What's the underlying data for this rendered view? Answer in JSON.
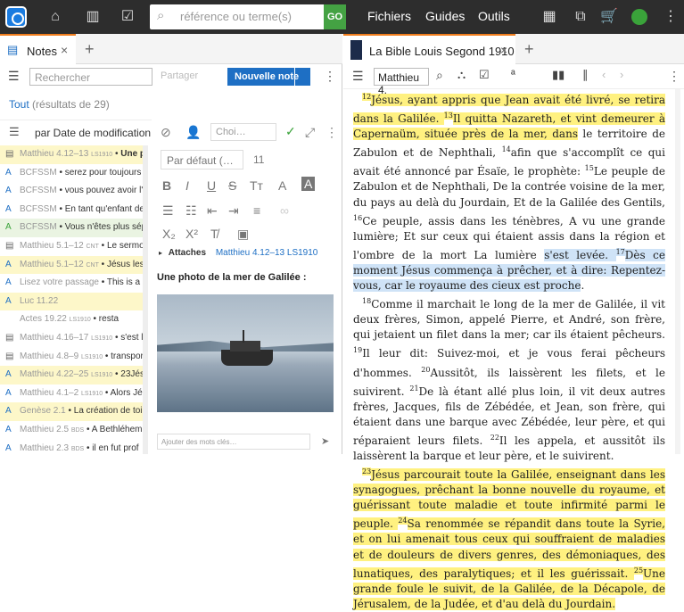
{
  "topbar": {
    "search_placeholder": "référence ou terme(s)",
    "go": "GO",
    "menus": [
      "Fichiers",
      "Guides",
      "Outils"
    ]
  },
  "left_tab": {
    "title": "Notes",
    "close": "×"
  },
  "right_tab": {
    "title": "La Bible Louis Segond 1910",
    "close": "×"
  },
  "notes_toolbar": {
    "search_placeholder": "Rechercher",
    "share": "Partager",
    "new_note": "Nouvelle note"
  },
  "filter": {
    "label": "Tout",
    "count": "(résultats de 29)"
  },
  "sort": {
    "label": "par Date de modification"
  },
  "notes": [
    {
      "icon": "note",
      "ref": "Matthieu 4.12–13",
      "abbr": "LS1910",
      "text": "Une p",
      "style": "hlY",
      "bold": true
    },
    {
      "icon": "A",
      "ref": "BCFSSM",
      "abbr": "",
      "text": "serez pour toujours l'",
      "style": ""
    },
    {
      "icon": "A",
      "ref": "BCFSSM",
      "abbr": "",
      "text": "vous pouvez avoir l'a",
      "style": ""
    },
    {
      "icon": "A",
      "ref": "BCFSSM",
      "abbr": "",
      "text": "En tant qu'enfant de",
      "style": ""
    },
    {
      "icon": "A",
      "ref": "BCFSSM",
      "abbr": "",
      "text": "Vous n'êtes plus sépa",
      "style": "hlG"
    },
    {
      "icon": "note",
      "ref": "Matthieu 5.1–12",
      "abbr": "CNT",
      "text": "Le sermo",
      "style": ""
    },
    {
      "icon": "A",
      "ref": "Matthieu 5.1–12",
      "abbr": "CNT",
      "text": "Jésus les",
      "style": "hlY"
    },
    {
      "icon": "A",
      "ref": "Lisez votre passage",
      "abbr": "",
      "text": "This is a te",
      "style": ""
    },
    {
      "icon": "A",
      "ref": "Luc 11.22",
      "abbr": "",
      "text": "",
      "style": "hlY"
    },
    {
      "icon": "",
      "ref": "Actes 19.22",
      "abbr": "LS1910",
      "text": "resta",
      "style": ""
    },
    {
      "icon": "note",
      "ref": "Matthieu 4.16–17",
      "abbr": "LS1910",
      "text": "s'est l",
      "style": ""
    },
    {
      "icon": "note",
      "ref": "Matthieu 4.8–9",
      "abbr": "LS1910",
      "text": "transpor",
      "style": ""
    },
    {
      "icon": "A",
      "ref": "Matthieu 4.22–25",
      "abbr": "LS1910",
      "text": "23Jés",
      "style": "hlY"
    },
    {
      "icon": "A",
      "ref": "Matthieu 4.1–2",
      "abbr": "LS1910",
      "text": "Alors Jé",
      "style": ""
    },
    {
      "icon": "A",
      "ref": "Genèse 2.1",
      "abbr": "",
      "text": "La création de toi",
      "style": "hlY"
    },
    {
      "icon": "A",
      "ref": "Matthieu 2.5",
      "abbr": "BDS",
      "text": "A Bethléhem",
      "style": ""
    },
    {
      "icon": "A",
      "ref": "Matthieu 2.3",
      "abbr": "BDS",
      "text": "il en fut prof",
      "style": ""
    }
  ],
  "editor": {
    "font": "Par défaut (…",
    "size": "11",
    "attaches_label": "Attaches",
    "attaches_ref": "Matthieu 4.12–13 LS1910",
    "photo_caption": "Une photo de la mer de Galilée :",
    "keywords_placeholder": "Ajouter des mots clés…",
    "choice": "Choi…"
  },
  "bible": {
    "ref": "Matthieu 4.",
    "paragraphs": [
      [
        [
          "12",
          "y"
        ],
        [
          "Jésus, ayant appris que Jean avait été livré, se retira dans la Galilée. ",
          "y"
        ],
        [
          "13",
          "y"
        ],
        [
          "Il quitta Nazareth, et vint demeurer à Capernaüm, située près de la mer, dans",
          "y"
        ],
        [
          " le territoire de Zabulon et de Nephthali, ",
          ""
        ],
        [
          "14",
          ""
        ],
        [
          "afin que s'accomplît ce qui avait été annoncé par Ésaïe, le prophète: ",
          ""
        ],
        [
          "15",
          ""
        ],
        [
          "Le peuple de Zabulon et de Nephthali, De la contrée voisine de la mer, du pays au delà du Jourdain, Et de la Galilée des Gentils, ",
          ""
        ],
        [
          "16",
          ""
        ],
        [
          "Ce peuple, assis dans les ténèbres, A vu une grande lumière; Et sur ceux qui étaient assis dans la région et l'ombre de la mort La lumière ",
          ""
        ],
        [
          "s'est levée. ",
          "b"
        ],
        [
          "17",
          "b"
        ],
        [
          "Dès ce moment Jésus commença à prêcher, et à dire: Repentez-vous, car le royaume des cieux est proche",
          "b"
        ],
        [
          ".",
          ""
        ]
      ],
      [
        [
          "18",
          ""
        ],
        [
          "Comme il marchait le long de la mer de Galilée, il vit deux frères, Simon, appelé Pierre, et André, son frère, qui jetaient un filet dans la mer; car ils étaient pêcheurs. ",
          ""
        ],
        [
          "19",
          ""
        ],
        [
          "Il leur dit: Suivez-moi, et je vous ferai pêcheurs d'hommes. ",
          ""
        ],
        [
          "20",
          ""
        ],
        [
          "Aussitôt, ils laissèrent les filets, et le suivirent. ",
          ""
        ],
        [
          "21",
          ""
        ],
        [
          "De là étant allé plus loin, il vit deux autres frères, Jacques, fils de Zébédée, et Jean, son frère, qui étaient dans une barque avec Zébédée, leur père, et qui réparaient leurs filets. ",
          ""
        ],
        [
          "22",
          ""
        ],
        [
          "Il les appela, et aussitôt ils laissèrent la barque et leur père, et le suivirent.",
          ""
        ]
      ],
      [
        [
          "23",
          "y"
        ],
        [
          "Jésus parcourait toute la Galilée, enseignant dans les synagogues, prêchant la bonne nouvelle du royaume, et guérissant toute maladie et toute infirmité parmi le peuple. ",
          "y"
        ],
        [
          "24",
          "y"
        ],
        [
          "Sa renommée se répandit dans toute la Syrie, et on lui amenait tous ceux qui souffraient de maladies et de douleurs de divers genres, des démoniaques, des lunatiques, des paralytiques; et il les guérissait. ",
          "y"
        ],
        [
          "25",
          "y"
        ],
        [
          "Une grande foule le suivit, de la Galilée, de la Décapole, de Jérusalem, de la Judée, et d'au delà du Jourdain.",
          "y"
        ]
      ]
    ]
  }
}
